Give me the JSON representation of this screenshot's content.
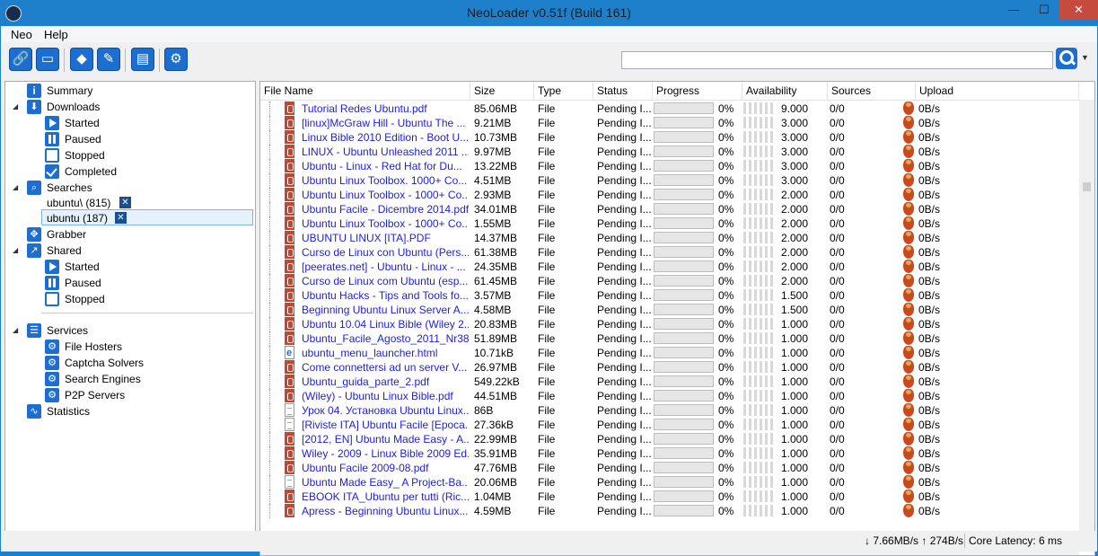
{
  "window": {
    "title": "NeoLoader v0.51f (Build 161)",
    "minimize": "—",
    "maximize": "☐",
    "close": "✕"
  },
  "menu": [
    "Neo",
    "Help"
  ],
  "toolbar": {
    "buttons": [
      {
        "name": "link-icon",
        "glyph": "🔗"
      },
      {
        "name": "window-icon",
        "glyph": "▭"
      },
      {
        "name": "dropbox-icon",
        "glyph": "◆"
      },
      {
        "name": "broom-icon",
        "glyph": "✎"
      },
      {
        "name": "browser-icon",
        "glyph": "▤"
      },
      {
        "name": "gears-icon",
        "glyph": "⚙"
      }
    ]
  },
  "search": {
    "value": "",
    "dropdown": "▼"
  },
  "sidebar": {
    "summary": "Summary",
    "downloads": {
      "label": "Downloads",
      "started": "Started",
      "paused": "Paused",
      "stopped": "Stopped",
      "completed": "Completed"
    },
    "searches": {
      "label": "Searches",
      "items": [
        {
          "label": "ubuntu\\ (815)"
        },
        {
          "label": "ubuntu (187)"
        }
      ]
    },
    "grabber": "Grabber",
    "shared": {
      "label": "Shared",
      "started": "Started",
      "paused": "Paused",
      "stopped": "Stopped"
    },
    "services": {
      "label": "Services",
      "file_hosters": "File Hosters",
      "captcha_solvers": "Captcha Solvers",
      "search_engines": "Search Engines",
      "p2p_servers": "P2P Servers"
    },
    "statistics": "Statistics"
  },
  "grid": {
    "columns": [
      "File Name",
      "Size",
      "Type",
      "Status",
      "Progress",
      "Availability",
      "Sources",
      "Upload"
    ],
    "rows": [
      {
        "name": "Tutorial Redes Ubuntu.pdf",
        "size": "85.06MB",
        "type": "File",
        "status": "Pending I...",
        "progress": "0%",
        "availability": "9.000",
        "sources": "0/0",
        "upload": "0B/s",
        "icon": "pdf"
      },
      {
        "name": "[linux]McGraw Hill - Ubuntu The ...",
        "size": "9.21MB",
        "type": "File",
        "status": "Pending I...",
        "progress": "0%",
        "availability": "3.000",
        "sources": "0/0",
        "upload": "0B/s",
        "icon": "pdf"
      },
      {
        "name": "Linux Bible 2010 Edition - Boot U...",
        "size": "10.73MB",
        "type": "File",
        "status": "Pending I...",
        "progress": "0%",
        "availability": "3.000",
        "sources": "0/0",
        "upload": "0B/s",
        "icon": "pdf"
      },
      {
        "name": "LINUX - Ubuntu Unleashed 2011 ...",
        "size": "9.97MB",
        "type": "File",
        "status": "Pending I...",
        "progress": "0%",
        "availability": "3.000",
        "sources": "0/0",
        "upload": "0B/s",
        "icon": "pdf"
      },
      {
        "name": "Ubuntu - Linux - Red Hat for Du...",
        "size": "13.22MB",
        "type": "File",
        "status": "Pending I...",
        "progress": "0%",
        "availability": "3.000",
        "sources": "0/0",
        "upload": "0B/s",
        "icon": "pdf"
      },
      {
        "name": "Ubuntu Linux Toolbox. 1000+ Co...",
        "size": "4.51MB",
        "type": "File",
        "status": "Pending I...",
        "progress": "0%",
        "availability": "3.000",
        "sources": "0/0",
        "upload": "0B/s",
        "icon": "pdf"
      },
      {
        "name": "Ubuntu Linux Toolbox - 1000+ Co...",
        "size": "2.93MB",
        "type": "File",
        "status": "Pending I...",
        "progress": "0%",
        "availability": "2.000",
        "sources": "0/0",
        "upload": "0B/s",
        "icon": "pdf"
      },
      {
        "name": "Ubuntu Facile - Dicembre 2014.pdf",
        "size": "34.01MB",
        "type": "File",
        "status": "Pending I...",
        "progress": "0%",
        "availability": "2.000",
        "sources": "0/0",
        "upload": "0B/s",
        "icon": "pdf"
      },
      {
        "name": "Ubuntu Linux Toolbox - 1000+ Co...",
        "size": "1.55MB",
        "type": "File",
        "status": "Pending I...",
        "progress": "0%",
        "availability": "2.000",
        "sources": "0/0",
        "upload": "0B/s",
        "icon": "pdf"
      },
      {
        "name": "UBUNTU LINUX [ITA].PDF",
        "size": "14.37MB",
        "type": "File",
        "status": "Pending I...",
        "progress": "0%",
        "availability": "2.000",
        "sources": "0/0",
        "upload": "0B/s",
        "icon": "pdf"
      },
      {
        "name": "Curso de Linux con Ubuntu (Pers...",
        "size": "61.38MB",
        "type": "File",
        "status": "Pending I...",
        "progress": "0%",
        "availability": "2.000",
        "sources": "0/0",
        "upload": "0B/s",
        "icon": "pdf"
      },
      {
        "name": "[peerates.net] - Ubuntu - Linux - ...",
        "size": "24.35MB",
        "type": "File",
        "status": "Pending I...",
        "progress": "0%",
        "availability": "2.000",
        "sources": "0/0",
        "upload": "0B/s",
        "icon": "pdf"
      },
      {
        "name": "Curso de Linux com Ubuntu (esp...",
        "size": "61.45MB",
        "type": "File",
        "status": "Pending I...",
        "progress": "0%",
        "availability": "2.000",
        "sources": "0/0",
        "upload": "0B/s",
        "icon": "pdf"
      },
      {
        "name": "Ubuntu Hacks - Tips and Tools fo...",
        "size": "3.57MB",
        "type": "File",
        "status": "Pending I...",
        "progress": "0%",
        "availability": "1.500",
        "sources": "0/0",
        "upload": "0B/s",
        "icon": "pdf"
      },
      {
        "name": "Beginning Ubuntu Linux Server A...",
        "size": "4.58MB",
        "type": "File",
        "status": "Pending I...",
        "progress": "0%",
        "availability": "1.500",
        "sources": "0/0",
        "upload": "0B/s",
        "icon": "pdf"
      },
      {
        "name": "Ubuntu 10.04 Linux Bible (Wiley 2...",
        "size": "20.83MB",
        "type": "File",
        "status": "Pending I...",
        "progress": "0%",
        "availability": "1.000",
        "sources": "0/0",
        "upload": "0B/s",
        "icon": "pdf"
      },
      {
        "name": "Ubuntu_Facile_Agosto_2011_Nr38...",
        "size": "51.89MB",
        "type": "File",
        "status": "Pending I...",
        "progress": "0%",
        "availability": "1.000",
        "sources": "0/0",
        "upload": "0B/s",
        "icon": "pdf"
      },
      {
        "name": "ubuntu_menu_launcher.html",
        "size": "10.71kB",
        "type": "File",
        "status": "Pending I...",
        "progress": "0%",
        "availability": "1.000",
        "sources": "0/0",
        "upload": "0B/s",
        "icon": "html"
      },
      {
        "name": "Come connettersi ad un server V...",
        "size": "26.97MB",
        "type": "File",
        "status": "Pending I...",
        "progress": "0%",
        "availability": "1.000",
        "sources": "0/0",
        "upload": "0B/s",
        "icon": "pdf"
      },
      {
        "name": "Ubuntu_guida_parte_2.pdf",
        "size": "549.22kB",
        "type": "File",
        "status": "Pending I...",
        "progress": "0%",
        "availability": "1.000",
        "sources": "0/0",
        "upload": "0B/s",
        "icon": "pdf"
      },
      {
        "name": "(Wiley) - Ubuntu Linux Bible.pdf",
        "size": "44.51MB",
        "type": "File",
        "status": "Pending I...",
        "progress": "0%",
        "availability": "1.000",
        "sources": "0/0",
        "upload": "0B/s",
        "icon": "pdf"
      },
      {
        "name": "Урок 04. Установка Ubuntu Linux...",
        "size": "86B",
        "type": "File",
        "status": "Pending I...",
        "progress": "0%",
        "availability": "1.000",
        "sources": "0/0",
        "upload": "0B/s",
        "icon": "doc"
      },
      {
        "name": "[Riviste ITA] Ubuntu Facile [Epoca...",
        "size": "27.36kB",
        "type": "File",
        "status": "Pending I...",
        "progress": "0%",
        "availability": "1.000",
        "sources": "0/0",
        "upload": "0B/s",
        "icon": "doc"
      },
      {
        "name": "[2012, EN] Ubuntu Made Easy - A...",
        "size": "22.99MB",
        "type": "File",
        "status": "Pending I...",
        "progress": "0%",
        "availability": "1.000",
        "sources": "0/0",
        "upload": "0B/s",
        "icon": "pdf"
      },
      {
        "name": "Wiley - 2009 - Linux Bible 2009 Ed...",
        "size": "35.91MB",
        "type": "File",
        "status": "Pending I...",
        "progress": "0%",
        "availability": "1.000",
        "sources": "0/0",
        "upload": "0B/s",
        "icon": "pdf"
      },
      {
        "name": "Ubuntu Facile 2009-08.pdf",
        "size": "47.76MB",
        "type": "File",
        "status": "Pending I...",
        "progress": "0%",
        "availability": "1.000",
        "sources": "0/0",
        "upload": "0B/s",
        "icon": "pdf"
      },
      {
        "name": "Ubuntu Made Easy_ A Project-Ba...",
        "size": "20.06MB",
        "type": "File",
        "status": "Pending I...",
        "progress": "0%",
        "availability": "1.000",
        "sources": "0/0",
        "upload": "0B/s",
        "icon": "doc"
      },
      {
        "name": "EBOOK ITA_Ubuntu per tutti (Ric...",
        "size": "1.04MB",
        "type": "File",
        "status": "Pending I...",
        "progress": "0%",
        "availability": "1.000",
        "sources": "0/0",
        "upload": "0B/s",
        "icon": "pdf"
      },
      {
        "name": "Apress - Beginning Ubuntu Linux...",
        "size": "4.59MB",
        "type": "File",
        "status": "Pending I...",
        "progress": "0%",
        "availability": "1.000",
        "sources": "0/0",
        "upload": "0B/s",
        "icon": "pdf"
      }
    ]
  },
  "statusbar": {
    "speed": "↓ 7.66MB/s ↑ 274B/s",
    "latency": "Core Latency: 6 ms"
  },
  "colors": {
    "titlebar": "#1e7fcb",
    "accent": "#1c6fd1",
    "close": "#c74a3e",
    "progress": "#06b025",
    "link_text": "#1f1fd1"
  }
}
